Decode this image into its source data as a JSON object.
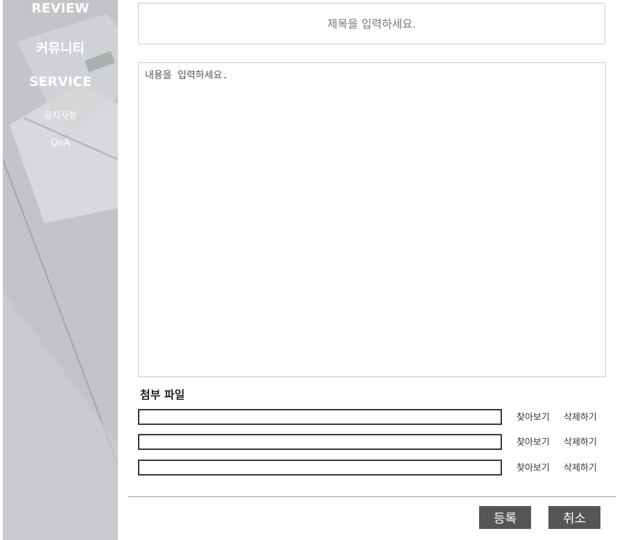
{
  "sidebar": {
    "items": [
      {
        "label": "REVIEW"
      },
      {
        "label": "커뮤니티"
      },
      {
        "label": "SERVICE"
      },
      {
        "label": "공지사항"
      },
      {
        "label": "QnA"
      }
    ]
  },
  "form": {
    "title_placeholder": "제목을 입력하세요.",
    "content_placeholder": "내용을 입력하세요.",
    "attachments_heading": "첨부 파일",
    "attachments": [
      {
        "browse_label": "찾아보기",
        "delete_label": "삭제하기"
      },
      {
        "browse_label": "찾아보기",
        "delete_label": "삭제하기"
      },
      {
        "browse_label": "찾아보기",
        "delete_label": "삭제하기"
      }
    ]
  },
  "actions": {
    "submit_label": "등록",
    "cancel_label": "취소"
  },
  "colors": {
    "button_bg": "#555555",
    "sidebar_bg": "#c6c7ca"
  }
}
